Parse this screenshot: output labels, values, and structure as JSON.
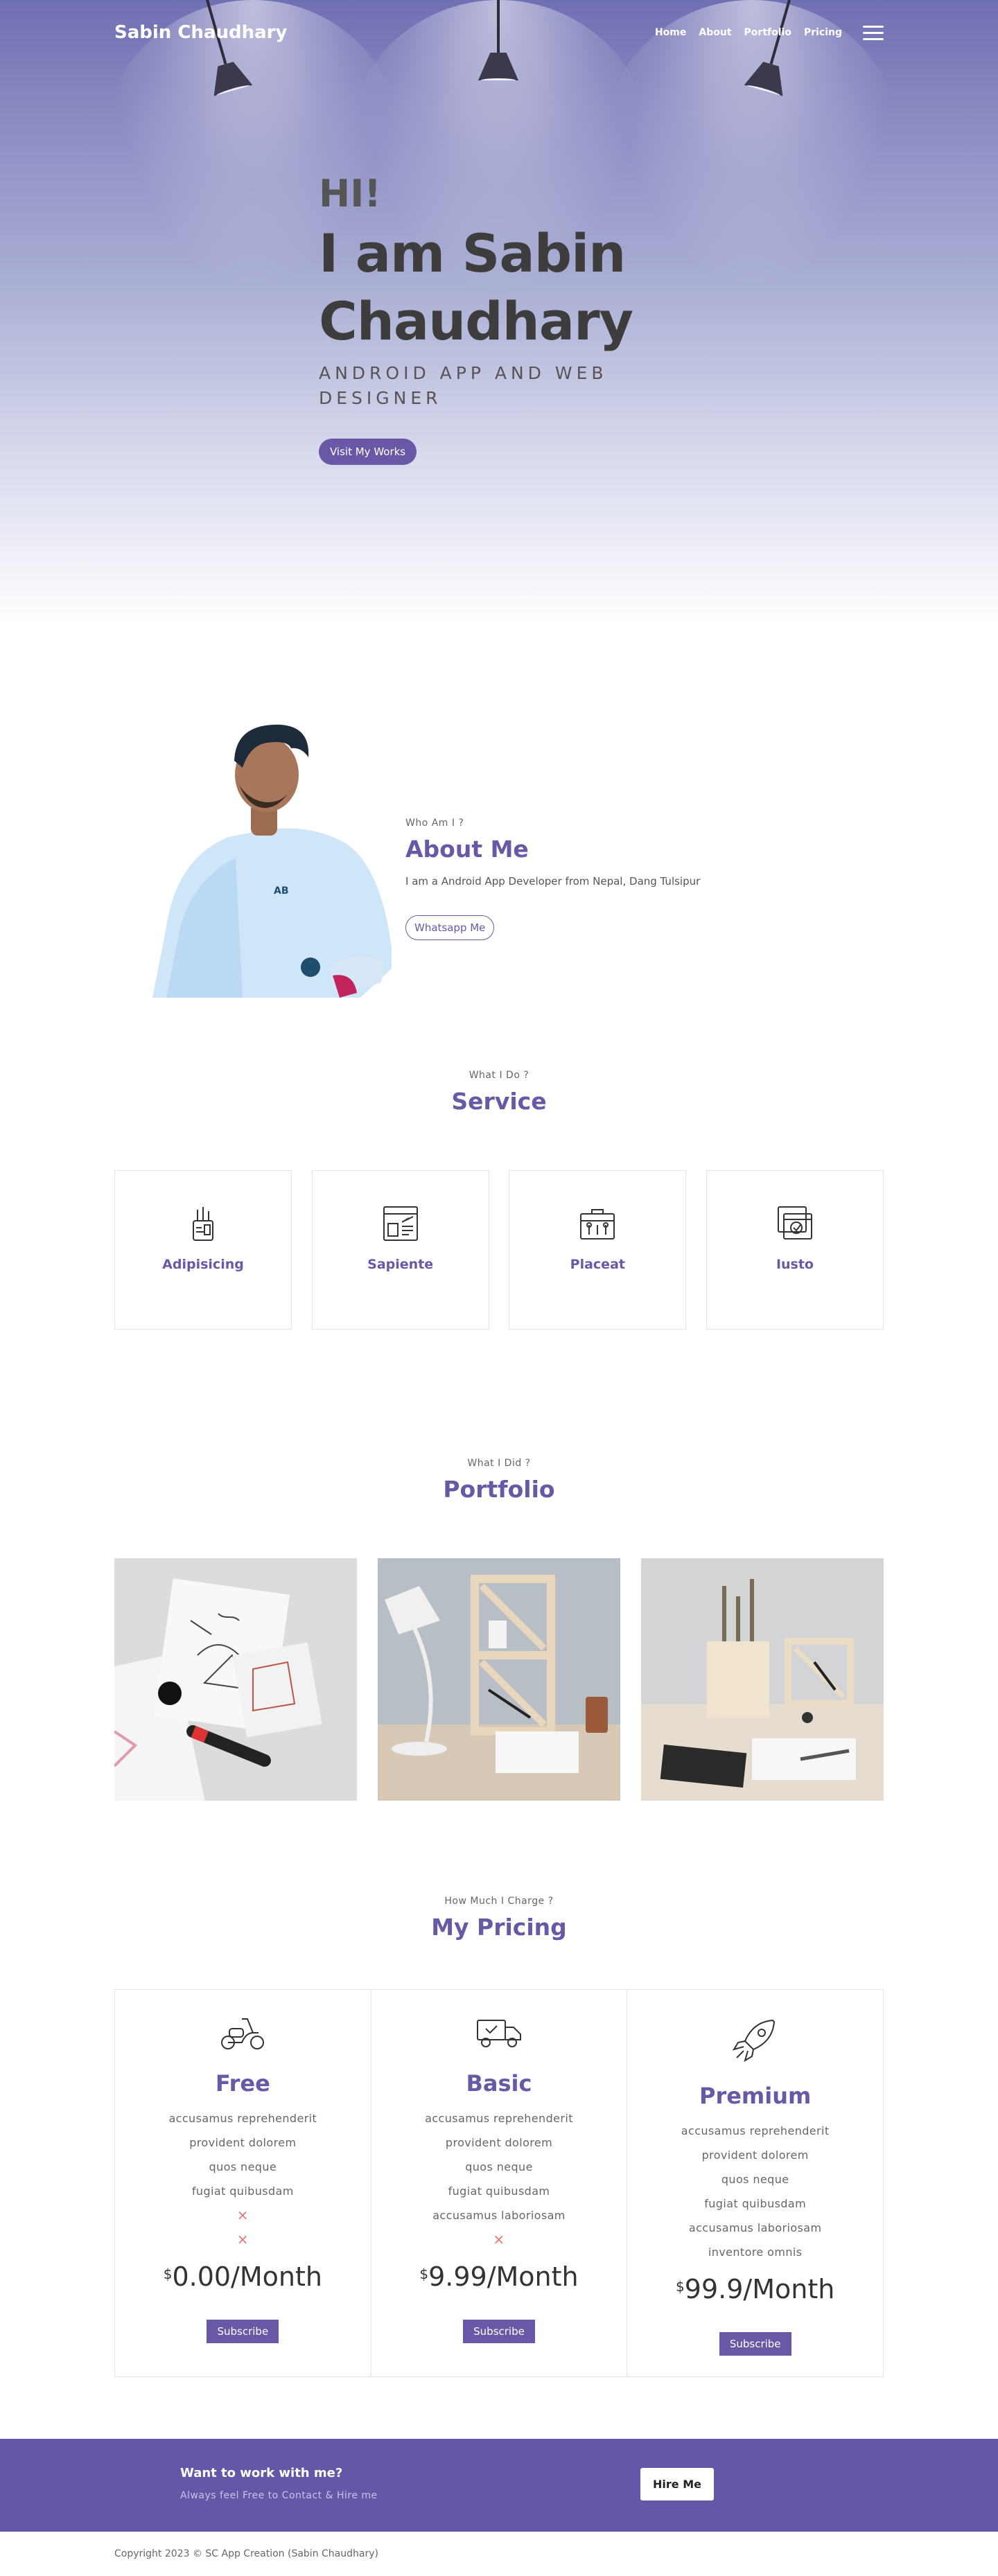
{
  "nav": {
    "brand": "Sabin Chaudhary",
    "links": [
      "Home",
      "About",
      "Portfolio",
      "Pricing"
    ],
    "menu_icon": "hamburger-icon"
  },
  "hero": {
    "greeting": "HI!",
    "name_line1": "I am Sabin",
    "name_line2": "Chaudhary",
    "role": "ANDROID APP AND WEB DESIGNER",
    "cta": "Visit My Works"
  },
  "about": {
    "eyebrow": "Who Am I ?",
    "title": "About Me",
    "desc": "I am a Android App Developer from Nepal, Dang Tulsipur",
    "cta": "Whatsapp Me"
  },
  "service": {
    "eyebrow": "What I Do ?",
    "title": "Service",
    "items": [
      {
        "title": "Adipisicing",
        "icon": "stationery-cup-icon"
      },
      {
        "title": "Sapiente",
        "icon": "web-design-icon"
      },
      {
        "title": "Placeat",
        "icon": "toolbox-icon"
      },
      {
        "title": "Iusto",
        "icon": "image-windows-icon"
      }
    ]
  },
  "portfolio": {
    "eyebrow": "What I Did ?",
    "title": "Portfolio"
  },
  "pricing": {
    "eyebrow": "How Much I Charge ?",
    "title": "My Pricing",
    "plans": [
      {
        "name": "Free",
        "icon": "scooter-icon",
        "features": [
          "accusamus reprehenderit",
          "provident dolorem",
          "quos neque",
          "fugiat quibusdam"
        ],
        "excluded": 2,
        "currency": "$",
        "price": "0.00/Month",
        "cta": "Subscribe"
      },
      {
        "name": "Basic",
        "icon": "delivery-truck-icon",
        "features": [
          "accusamus reprehenderit",
          "provident dolorem",
          "quos neque",
          "fugiat quibusdam",
          "accusamus laboriosam"
        ],
        "excluded": 1,
        "currency": "$",
        "price": "9.99/Month",
        "cta": "Subscribe"
      },
      {
        "name": "Premium",
        "icon": "rocket-icon",
        "features": [
          "accusamus reprehenderit",
          "provident dolorem",
          "quos neque",
          "fugiat quibusdam",
          "accusamus laboriosam",
          "inventore omnis"
        ],
        "excluded": 0,
        "currency": "$",
        "price": "99.9/Month",
        "cta": "Subscribe"
      }
    ],
    "excluded_mark": "×"
  },
  "cta": {
    "question": "Want to work with me?",
    "sub": "Always feel Free to Contact & Hire me",
    "button": "Hire Me"
  },
  "footer": {
    "copyright": "Copyright 2023 © SC App Creation (Sabin Chaudhary)"
  },
  "colors": {
    "accent": "#6858a6",
    "cta_band": "#6557a7",
    "excluded": "#e57373"
  }
}
